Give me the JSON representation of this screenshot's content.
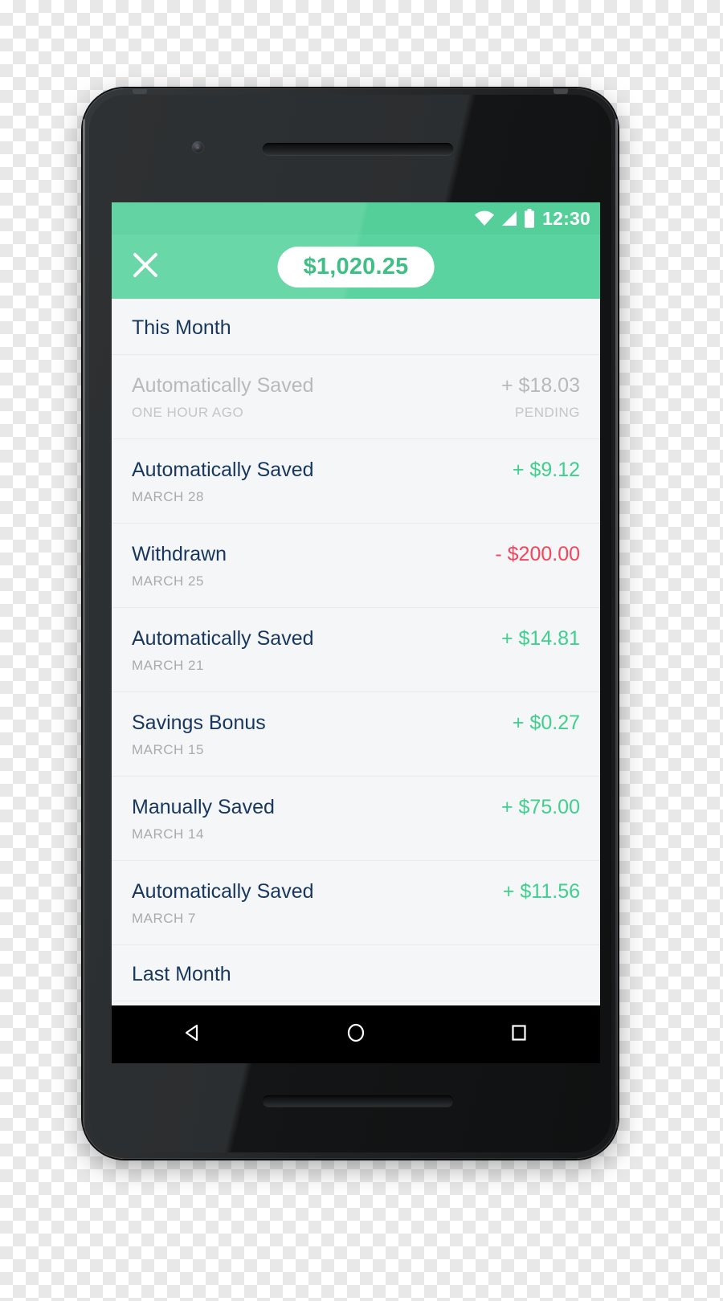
{
  "status_bar": {
    "time": "12:30",
    "wifi_icon": "wifi-icon",
    "signal_icon": "cell-signal-icon",
    "battery_icon": "battery-icon"
  },
  "app_bar": {
    "close_icon": "close-icon",
    "balance": "$1,020.25"
  },
  "colors": {
    "accent_green": "#5bd3a0",
    "status_bar_green": "#55cf9a",
    "positive": "#3fcf8e",
    "negative": "#f5455c",
    "title_navy": "#17375e",
    "muted_grey": "#a8abaf",
    "screen_bg": "#f5f6f7"
  },
  "sections": [
    {
      "header": "This Month",
      "transactions": [
        {
          "title": "Automatically Saved",
          "date": "ONE HOUR AGO",
          "amount": "+ $18.03",
          "status": "PENDING",
          "pending": true,
          "sign": "positive"
        },
        {
          "title": "Automatically Saved",
          "date": "MARCH 28",
          "amount": "+ $9.12",
          "status": "",
          "pending": false,
          "sign": "positive"
        },
        {
          "title": "Withdrawn",
          "date": "MARCH 25",
          "amount": "- $200.00",
          "status": "",
          "pending": false,
          "sign": "negative"
        },
        {
          "title": "Automatically Saved",
          "date": "MARCH 21",
          "amount": "+ $14.81",
          "status": "",
          "pending": false,
          "sign": "positive"
        },
        {
          "title": "Savings Bonus",
          "date": "MARCH 15",
          "amount": "+ $0.27",
          "status": "",
          "pending": false,
          "sign": "positive"
        },
        {
          "title": "Manually Saved",
          "date": "MARCH 14",
          "amount": "+ $75.00",
          "status": "",
          "pending": false,
          "sign": "positive"
        },
        {
          "title": "Automatically Saved",
          "date": "MARCH 7",
          "amount": "+ $11.56",
          "status": "",
          "pending": false,
          "sign": "positive"
        }
      ]
    },
    {
      "header": "Last Month",
      "transactions": []
    }
  ],
  "nav_bar": {
    "back_icon": "back-triangle-icon",
    "home_icon": "home-circle-icon",
    "recents_icon": "recents-square-icon"
  },
  "hardware": {
    "front_camera": "front-camera",
    "earpiece": "earpiece-speaker",
    "bottom_speaker": "bottom-speaker-grille"
  }
}
